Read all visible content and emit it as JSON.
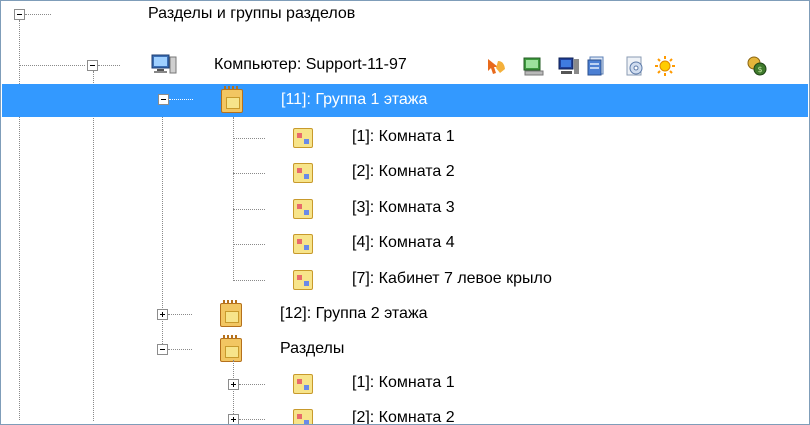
{
  "tree": {
    "root_label": "Разделы и группы разделов",
    "computer_label": "Компьютер: Support-11-97",
    "group1": {
      "label": "[11]: Группа 1 этажа",
      "children": [
        "[1]: Комната 1",
        "[2]: Комната 2",
        "[3]: Комната 3",
        "[4]: Комната 4",
        "[7]: Кабинет 7 левое крыло"
      ]
    },
    "group2_label": "[12]: Группа 2 этажа",
    "sections": {
      "label": "Разделы",
      "children": [
        "[1]: Комната 1",
        "[2]: Комната 2"
      ]
    }
  },
  "toolbar_icons": [
    "arrow-hand-icon",
    "monitor-green-icon",
    "computer-blue-icon",
    "document-blue-icon",
    "disc-icon",
    "sun-icon",
    "coins-icon"
  ],
  "colors": {
    "selection": "#3399ff",
    "selection_text": "#ffffff",
    "tree_lines": "#8a8a8a"
  }
}
